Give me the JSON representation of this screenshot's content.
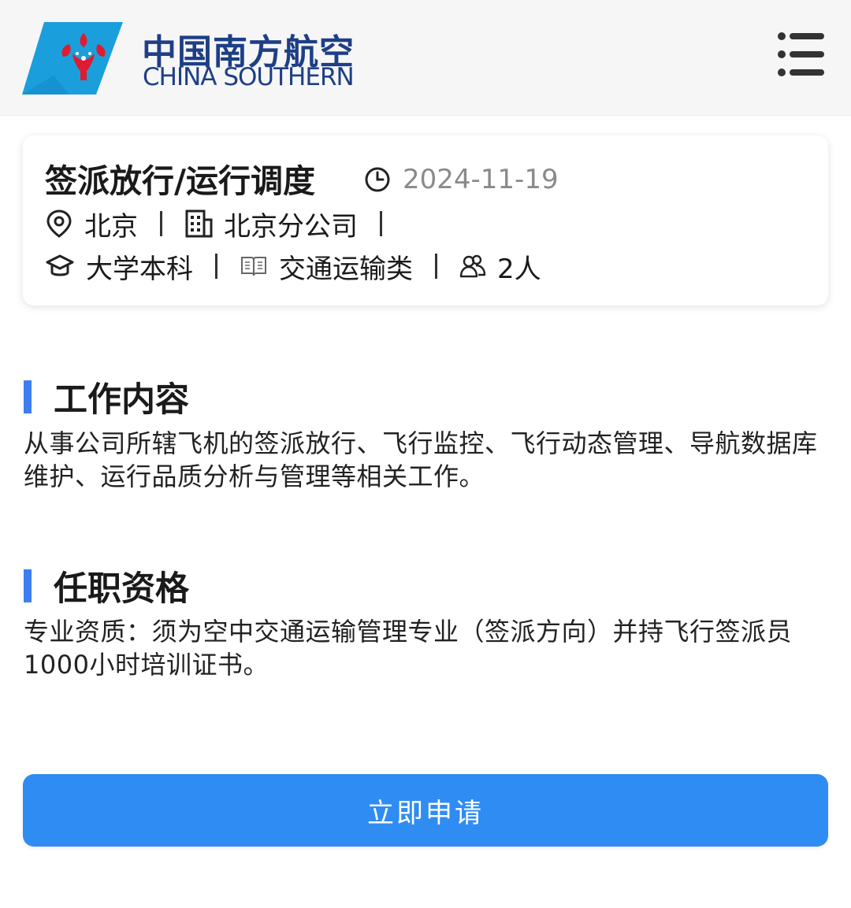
{
  "header": {
    "logo_cn": "中国南方航空",
    "logo_en": "CHINA SOUTHERN",
    "brand_color": "#1e3f86",
    "logo_accent": "#1a9fdc",
    "logo_flower": "#e01b2f",
    "menu_icon": "hamburger-menu-icon"
  },
  "job": {
    "title": "签派放行/运行调度",
    "date": "2024-11-19",
    "location": "北京",
    "company": "北京分公司",
    "education": "大学本科",
    "category": "交通运输类",
    "headcount": "2人"
  },
  "sections": {
    "duties_title": "工作内容",
    "duties_text": "从事公司所辖飞机的签派放行、飞行监控、飞行动态管理、导航数据库维护、运行品质分析与管理等相关工作。",
    "requirements_title": "任职资格",
    "requirements_text": "专业资质：须为空中交通运输管理专业（签派方向）并持飞行签派员1000小时培训证书。"
  },
  "actions": {
    "apply_label": "立即申请",
    "accent": "#2f8cf3"
  }
}
